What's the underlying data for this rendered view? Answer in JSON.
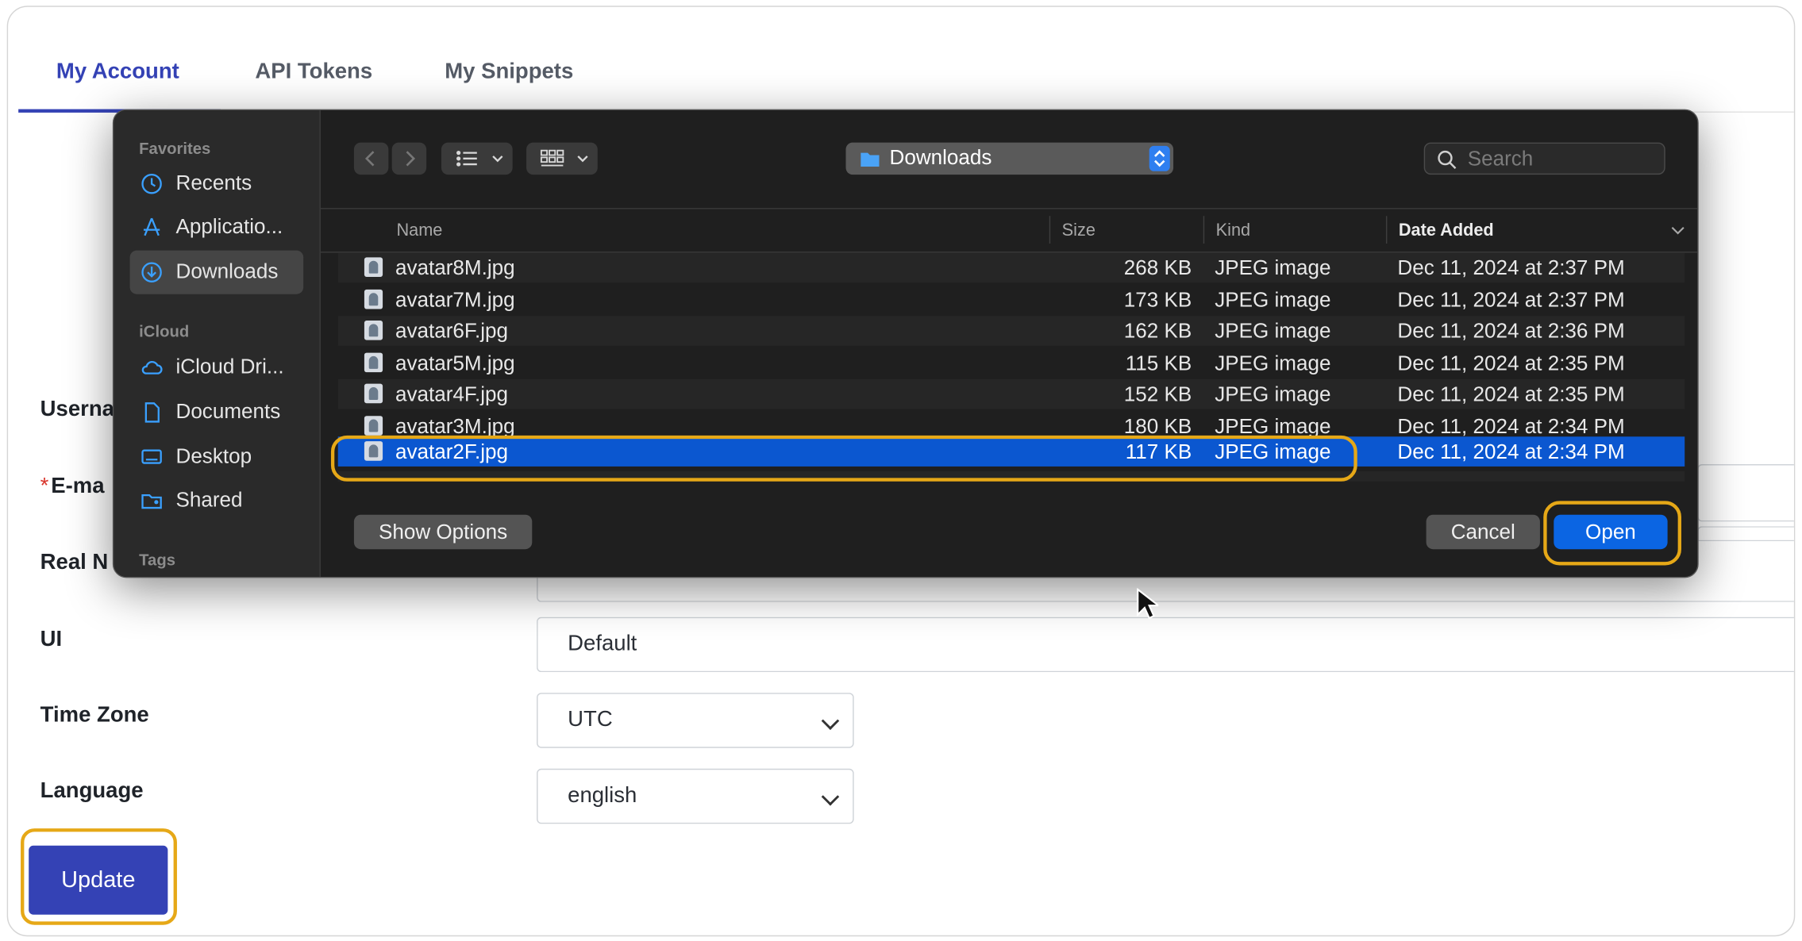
{
  "tabs": [
    "My Account",
    "API Tokens",
    "My Snippets"
  ],
  "form": {
    "username_label": "Userna",
    "email_required": "*",
    "email_label": "E-ma",
    "realname_label": "Real N",
    "ui_label": "UI",
    "ui_value": "Default",
    "timezone_label": "Time Zone",
    "timezone_value": "UTC",
    "language_label": "Language",
    "language_value": "english",
    "update_label": "Update"
  },
  "dialog": {
    "sidebar": {
      "favorites_heading": "Favorites",
      "favorites": [
        {
          "label": "Recents",
          "icon": "clock-icon"
        },
        {
          "label": "Applicatio...",
          "icon": "applications-icon"
        },
        {
          "label": "Downloads",
          "icon": "downloads-icon",
          "selected": true
        }
      ],
      "icloud_heading": "iCloud",
      "icloud": [
        {
          "label": "iCloud Dri...",
          "icon": "cloud-icon"
        },
        {
          "label": "Documents",
          "icon": "document-icon"
        },
        {
          "label": "Desktop",
          "icon": "desktop-icon"
        },
        {
          "label": "Shared",
          "icon": "shared-folder-icon"
        }
      ],
      "tags_heading": "Tags"
    },
    "location": "Downloads",
    "search_placeholder": "Search",
    "columns": {
      "name": "Name",
      "size": "Size",
      "kind": "Kind",
      "date": "Date Added"
    },
    "files": [
      {
        "name": "avatar8M.jpg",
        "size": "268 KB",
        "kind": "JPEG image",
        "date": "Dec 11, 2024 at 2:37 PM"
      },
      {
        "name": "avatar7M.jpg",
        "size": "173 KB",
        "kind": "JPEG image",
        "date": "Dec 11, 2024 at 2:37 PM"
      },
      {
        "name": "avatar6F.jpg",
        "size": "162 KB",
        "kind": "JPEG image",
        "date": "Dec 11, 2024 at 2:36 PM"
      },
      {
        "name": "avatar5M.jpg",
        "size": "115 KB",
        "kind": "JPEG image",
        "date": "Dec 11, 2024 at 2:35 PM"
      },
      {
        "name": "avatar4F.jpg",
        "size": "152 KB",
        "kind": "JPEG image",
        "date": "Dec 11, 2024 at 2:35 PM"
      },
      {
        "name": "avatar3M.jpg",
        "size": "180 KB",
        "kind": "JPEG image",
        "date": "Dec 11, 2024 at 2:34 PM"
      },
      {
        "name": "avatar2F.jpg",
        "size": "117 KB",
        "kind": "JPEG image",
        "date": "Dec 11, 2024 at 2:34 PM",
        "selected": true
      }
    ],
    "show_options_label": "Show Options",
    "cancel_label": "Cancel",
    "open_label": "Open"
  },
  "colors": {
    "accent": "#3442b5",
    "selection": "#0b57d0",
    "highlight": "#e6a817"
  }
}
